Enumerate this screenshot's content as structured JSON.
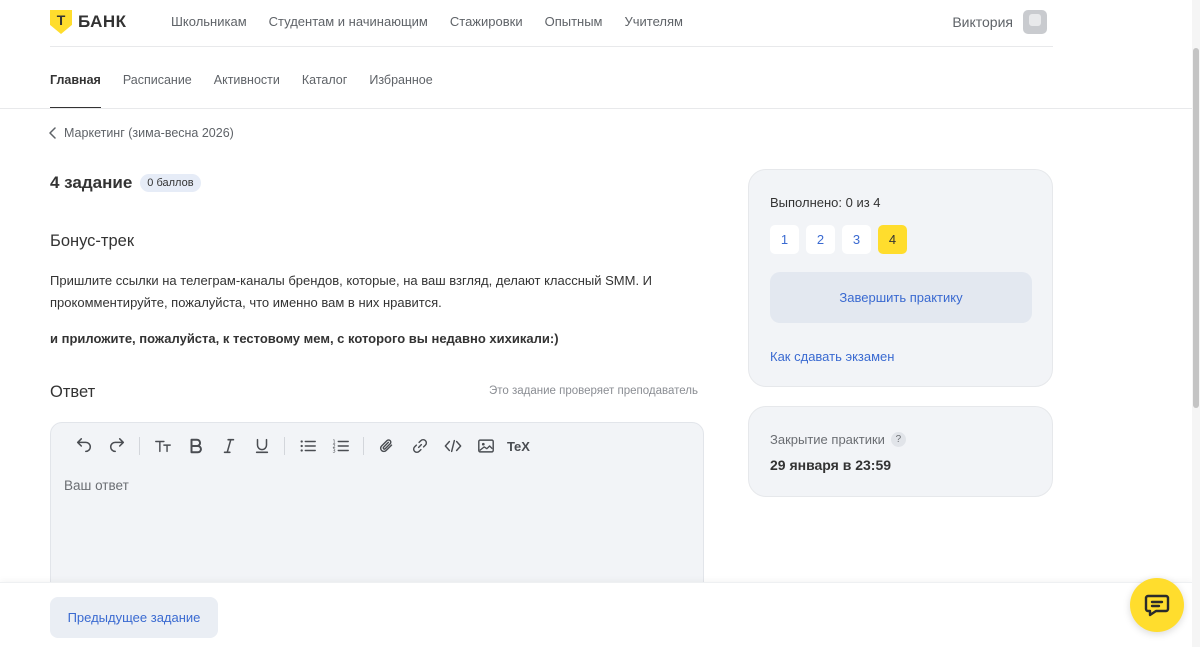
{
  "brand": {
    "logo_letter": "Т",
    "name": "БАНК"
  },
  "topnav": [
    "Школьникам",
    "Студентам и начинающим",
    "Стажировки",
    "Опытным",
    "Учителям"
  ],
  "user": {
    "name": "Виктория"
  },
  "subnav": {
    "items": [
      "Главная",
      "Расписание",
      "Активности",
      "Каталог",
      "Избранное"
    ],
    "active_index": 0
  },
  "breadcrumb": "Маркетинг (зима-весна 2026)",
  "task": {
    "title": "4 задание",
    "points": "0 баллов",
    "section": "Бонус-трек",
    "description": "Пришлите ссылки на телеграм-каналы брендов, которые, на ваш взгляд, делают классный SMM. И прокомментируйте, пожалуйста, что именно вам в них нравится.",
    "description_bold": "и приложите, пожалуйста, к тестовому мем, с которого вы недавно хихикали:)"
  },
  "answer": {
    "title": "Ответ",
    "note": "Это задание проверяет преподаватель",
    "placeholder": "Ваш ответ",
    "toolbar": {
      "tex_label": "TeX"
    }
  },
  "progress_card": {
    "done_text": "Выполнено: 0 из 4",
    "pages": [
      "1",
      "2",
      "3",
      "4"
    ],
    "active_page": "4",
    "finish_label": "Завершить практику",
    "exam_link": "Как сдавать экзамен"
  },
  "deadline_card": {
    "label": "Закрытие практики",
    "help": "?",
    "date": "29 января в 23:59"
  },
  "footer": {
    "prev_label": "Предыдущее задание"
  },
  "colors": {
    "accent": "#ffdd2d",
    "link": "#3a6ad1",
    "card_bg": "#f2f4f7"
  }
}
